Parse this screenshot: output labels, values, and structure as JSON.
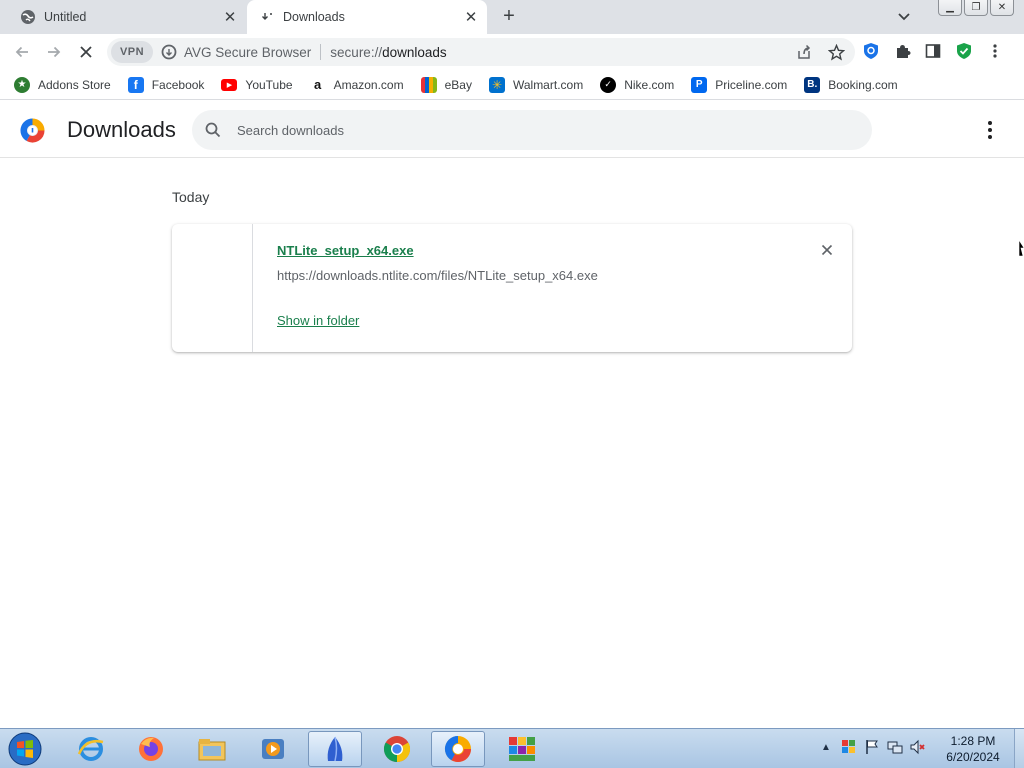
{
  "tabs": [
    {
      "title": "Untitled",
      "icon": "globe-icon",
      "active": false
    },
    {
      "title": "Downloads",
      "icon": "downloads-tab-icon",
      "active": true
    }
  ],
  "toolbar": {
    "vpn_label": "VPN",
    "brand": "AVG Secure Browser",
    "url_scheme": "secure://",
    "url_path": "downloads"
  },
  "bookmarks": [
    {
      "label": "Addons Store",
      "icon": "addons-store-icon",
      "color": "#2e7d32"
    },
    {
      "label": "Facebook",
      "icon": "facebook-icon",
      "color": "#1877f2"
    },
    {
      "label": "YouTube",
      "icon": "youtube-icon",
      "color": "#ff0000"
    },
    {
      "label": "Amazon.com",
      "icon": "amazon-icon",
      "color": "#111111"
    },
    {
      "label": "eBay",
      "icon": "ebay-icon",
      "color": "#e53238"
    },
    {
      "label": "Walmart.com",
      "icon": "walmart-icon",
      "color": "#0071ce"
    },
    {
      "label": "Nike.com",
      "icon": "nike-icon",
      "color": "#000000"
    },
    {
      "label": "Priceline.com",
      "icon": "priceline-icon",
      "color": "#0068ef"
    },
    {
      "label": "Booking.com",
      "icon": "booking-icon",
      "color": "#003580"
    }
  ],
  "downloads_page": {
    "title": "Downloads",
    "search_placeholder": "Search downloads",
    "section_date": "Today",
    "items": [
      {
        "file_name": "NTLite_setup_x64.exe",
        "url": "https://downloads.ntlite.com/files/NTLite_setup_x64.exe",
        "action": "Show in folder"
      }
    ]
  },
  "taskbar": {
    "apps": [
      "internet-explorer-icon",
      "firefox-icon",
      "file-explorer-icon",
      "media-player-icon",
      "app-blue-icon",
      "chrome-icon",
      "avg-browser-icon",
      "avg-antivirus-icon"
    ],
    "time": "1:28 PM",
    "date": "6/20/2024"
  },
  "colors": {
    "accent_green": "#1a7f4c",
    "tab_strip": "#dee1e6",
    "omnibox": "#f1f3f4"
  }
}
